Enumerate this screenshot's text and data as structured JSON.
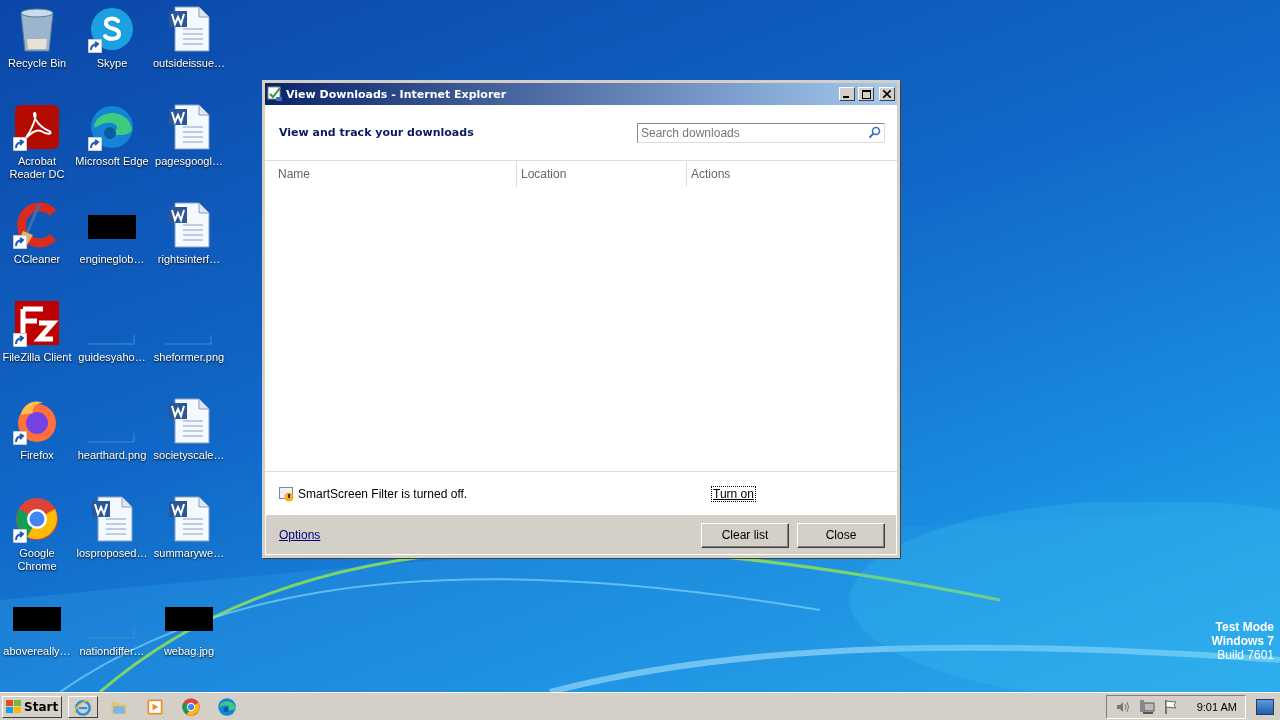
{
  "desktop": {
    "icons": [
      {
        "label": "Recycle Bin",
        "kind": "recycle-bin",
        "shortcut": false
      },
      {
        "label": "Skype",
        "kind": "skype",
        "shortcut": true
      },
      {
        "label": "outsideissue…",
        "kind": "word-doc",
        "shortcut": false
      },
      {
        "label": "Acrobat Reader DC",
        "kind": "acrobat",
        "shortcut": true
      },
      {
        "label": "Microsoft Edge",
        "kind": "edge",
        "shortcut": true
      },
      {
        "label": "pagesgoogl…",
        "kind": "word-doc",
        "shortcut": false
      },
      {
        "label": "CCleaner",
        "kind": "ccleaner",
        "shortcut": true
      },
      {
        "label": "engineglob…",
        "kind": "dark-thumbnail",
        "shortcut": false
      },
      {
        "label": "rightsinterf…",
        "kind": "word-doc",
        "shortcut": false
      },
      {
        "label": "FileZilla Client",
        "kind": "filezilla",
        "shortcut": true
      },
      {
        "label": "guidesyaho…",
        "kind": "blank-thumbnail",
        "shortcut": false
      },
      {
        "label": "sheformer.png",
        "kind": "blank-thumbnail",
        "shortcut": false
      },
      {
        "label": "Firefox",
        "kind": "firefox",
        "shortcut": true
      },
      {
        "label": "hearthard.png",
        "kind": "blank-thumbnail",
        "shortcut": false
      },
      {
        "label": "societyscale…",
        "kind": "word-doc",
        "shortcut": false
      },
      {
        "label": "Google Chrome",
        "kind": "chrome",
        "shortcut": true
      },
      {
        "label": "losproposed…",
        "kind": "word-doc",
        "shortcut": false
      },
      {
        "label": "summarywe…",
        "kind": "word-doc",
        "shortcut": false
      },
      {
        "label": "abovereally…",
        "kind": "dark-thumbnail",
        "shortcut": false
      },
      {
        "label": "nationdiffer…",
        "kind": "blank-thumbnail",
        "shortcut": false
      },
      {
        "label": "webag.jpg",
        "kind": "dark-thumbnail",
        "shortcut": false
      }
    ]
  },
  "window": {
    "title": "View Downloads - Internet Explorer",
    "heading": "View and track your downloads",
    "search": {
      "placeholder": "Search downloads"
    },
    "columns": [
      "Name",
      "Location",
      "Actions"
    ],
    "smartscreen": {
      "message": "SmartScreen Filter is turned off.",
      "link": "Turn on",
      "focused": true
    },
    "options_link": "Options",
    "buttons": [
      "Clear list",
      "Close"
    ]
  },
  "system_info": [
    "Test Mode",
    "Windows 7",
    "Build 7601"
  ],
  "taskbar": {
    "start": "Start",
    "apps": [
      {
        "kind": "ie",
        "selected": true
      },
      {
        "kind": "explorer",
        "selected": false
      },
      {
        "kind": "media-player",
        "selected": false
      },
      {
        "kind": "chrome",
        "selected": false
      },
      {
        "kind": "edge",
        "selected": false
      }
    ],
    "clock": "9:01 AM"
  }
}
